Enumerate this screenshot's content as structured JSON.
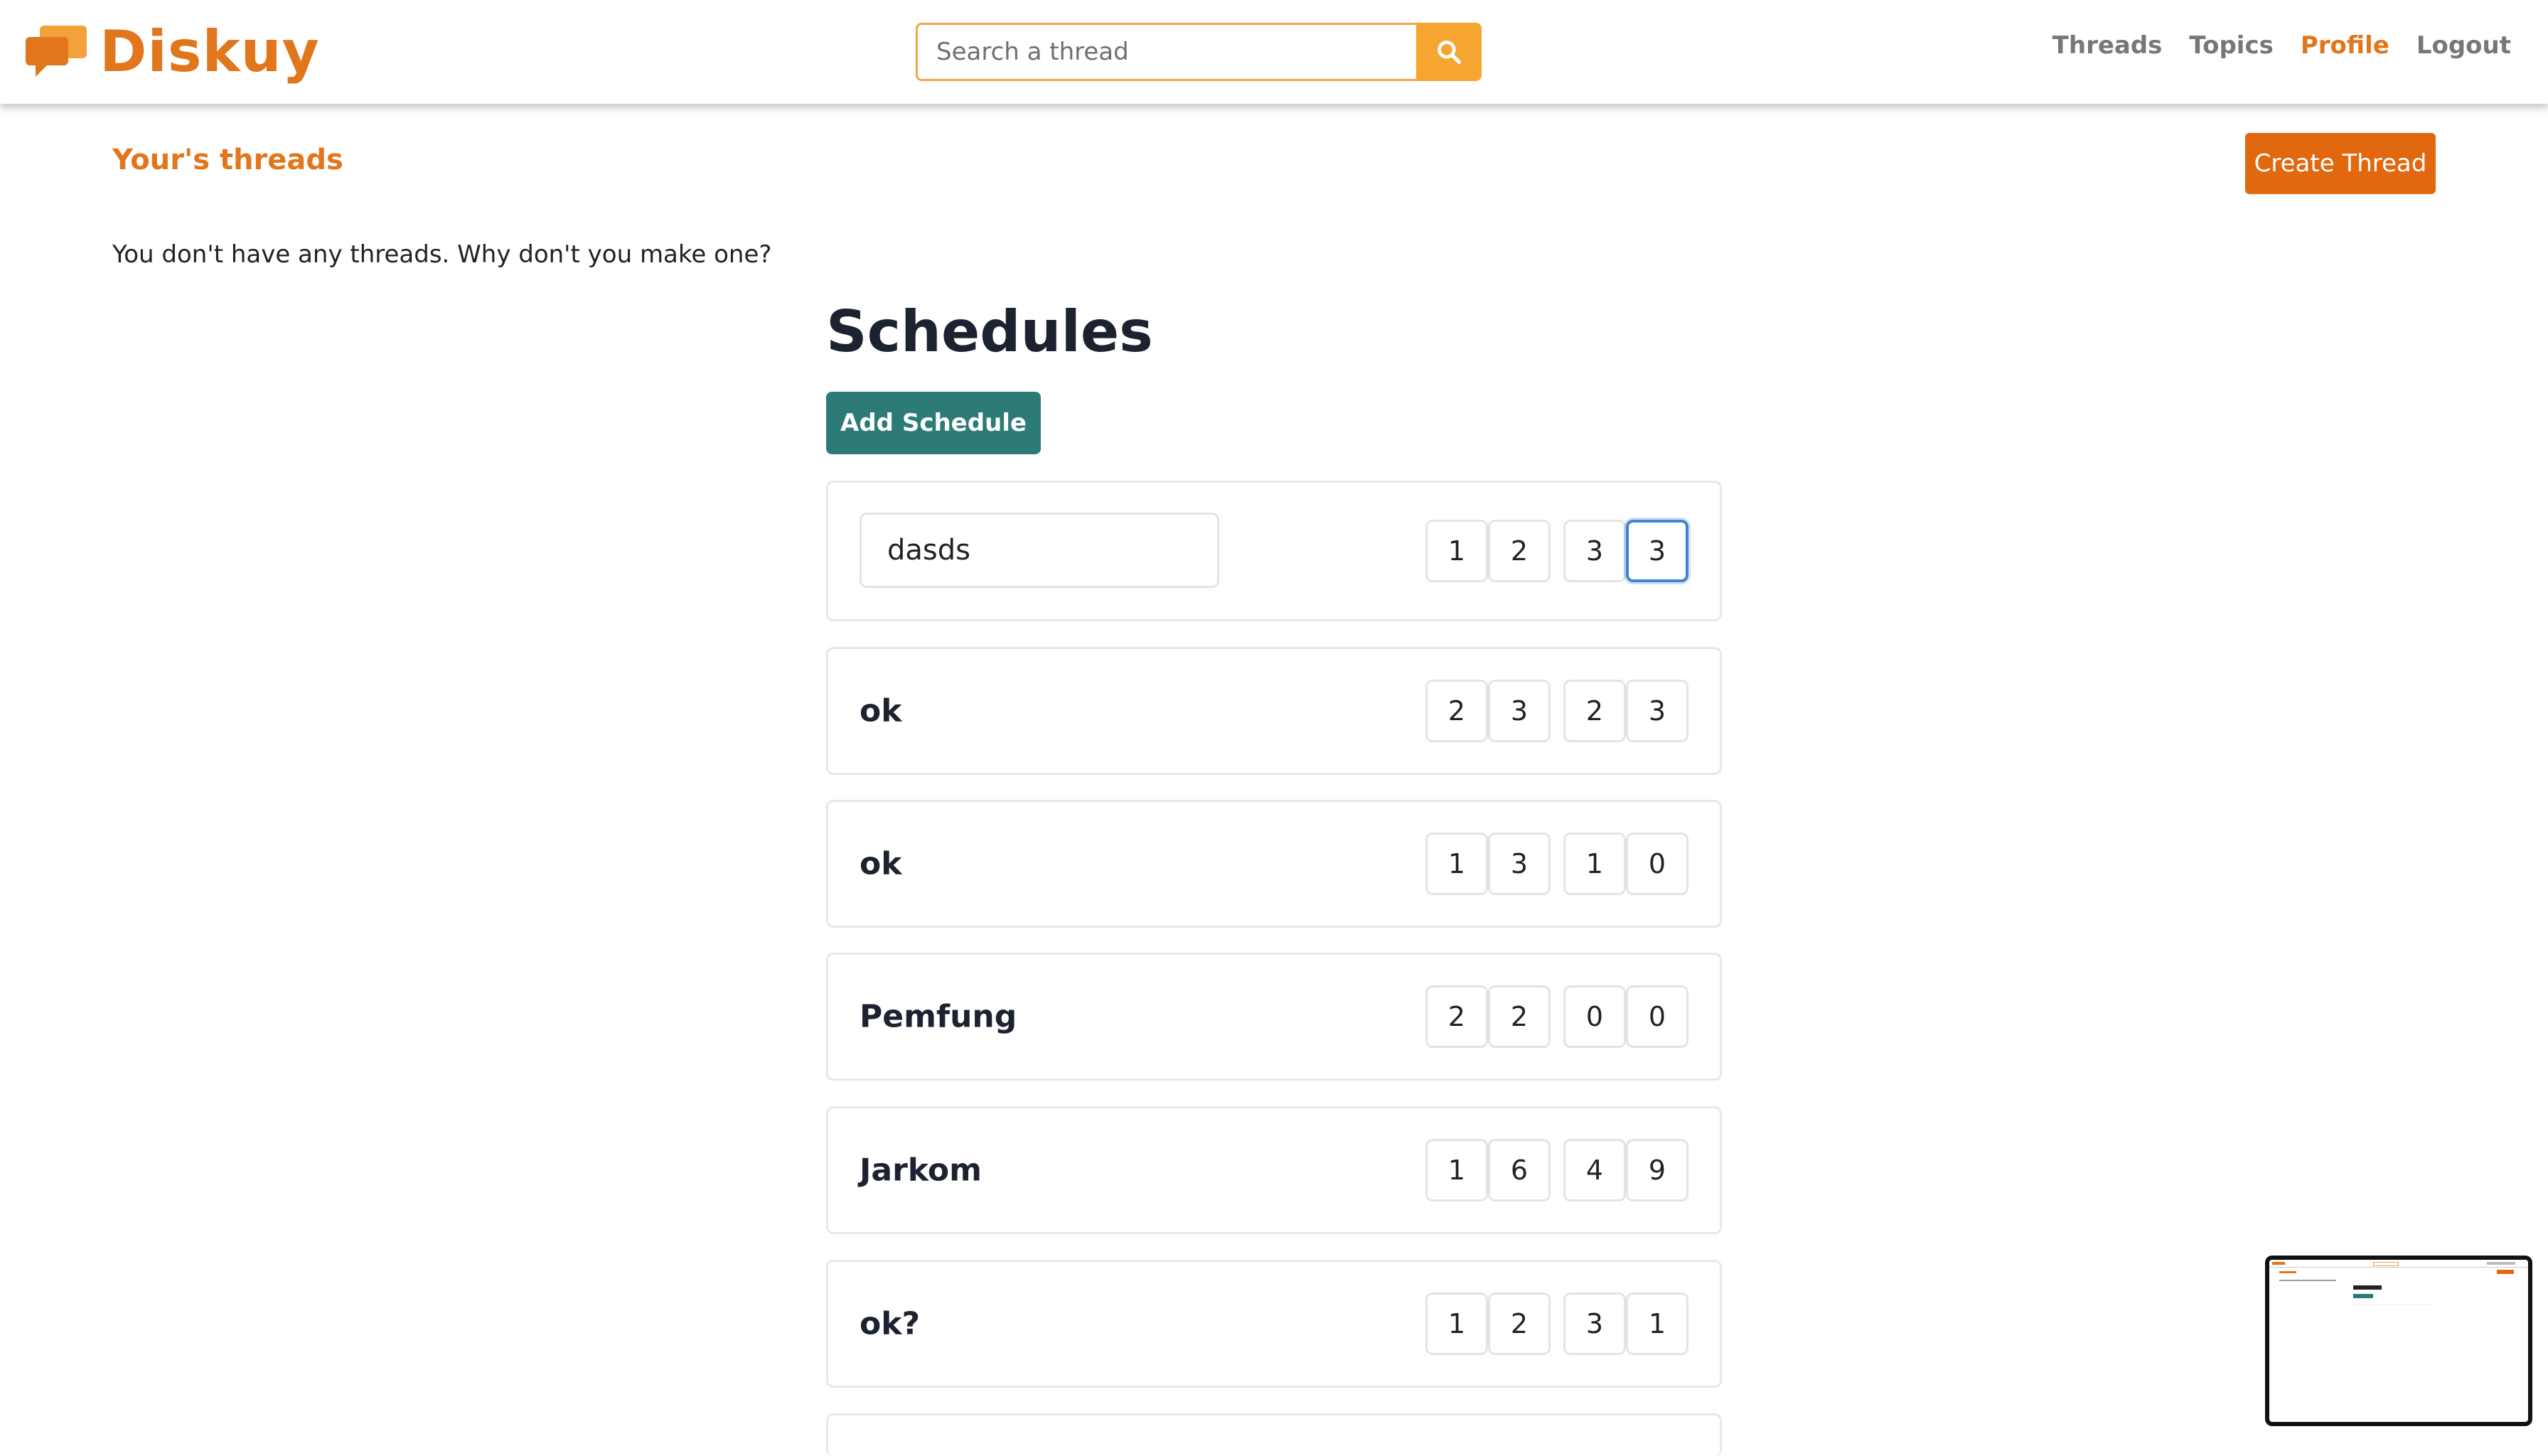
{
  "app": {
    "name": "Diskuy"
  },
  "search": {
    "placeholder": "Search a thread"
  },
  "nav": {
    "links": [
      {
        "label": "Threads",
        "active": false
      },
      {
        "label": "Topics",
        "active": false
      },
      {
        "label": "Profile",
        "active": true
      },
      {
        "label": "Logout",
        "active": false
      }
    ]
  },
  "threads": {
    "title": "Your's threads",
    "create_label": "Create Thread",
    "empty_message": "You don't have any threads. Why don't you make one?"
  },
  "schedules": {
    "title": "Schedules",
    "add_label": "Add Schedule",
    "editing": {
      "name": "dasds",
      "digits": [
        "1",
        "2",
        "3",
        "3"
      ]
    },
    "items": [
      {
        "name": "ok",
        "digits": [
          "2",
          "3",
          "2",
          "3"
        ]
      },
      {
        "name": "ok",
        "digits": [
          "1",
          "3",
          "1",
          "0"
        ]
      },
      {
        "name": "Pemfung",
        "digits": [
          "2",
          "2",
          "0",
          "0"
        ]
      },
      {
        "name": "Jarkom",
        "digits": [
          "1",
          "6",
          "4",
          "9"
        ]
      },
      {
        "name": "ok?",
        "digits": [
          "1",
          "2",
          "3",
          "1"
        ]
      }
    ]
  },
  "colors": {
    "brand": "#e2761c",
    "search_button": "#f7a531",
    "create_button": "#e2680f",
    "add_button": "#2c7b77",
    "focus": "#3f86cf"
  },
  "icons": {
    "logo": "chat-bubbles-icon",
    "search": "search-icon"
  }
}
